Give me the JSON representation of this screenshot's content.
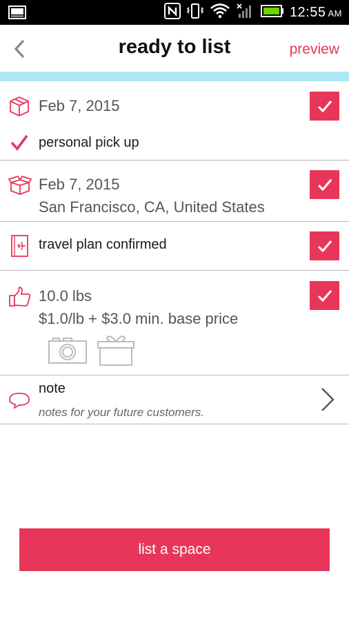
{
  "status_bar": {
    "time": "12:55",
    "ampm": "AM"
  },
  "header": {
    "title": "ready to list",
    "preview_label": "preview"
  },
  "rows": {
    "pickup": {
      "date": "Feb 7, 2015",
      "method": "personal pick up",
      "checked": true
    },
    "delivery": {
      "date": "Feb 7, 2015",
      "location": "San Francisco, CA, United States",
      "checked": true
    },
    "travel": {
      "label": "travel plan confirmed",
      "checked": true
    },
    "weight": {
      "weight": "10.0 lbs",
      "price": "$1.0/lb + $3.0 min. base price",
      "checked": true
    },
    "note": {
      "label": "note",
      "placeholder": "notes for your future customers."
    }
  },
  "footer": {
    "list_button_label": "list a space"
  },
  "colors": {
    "accent": "#e8365a",
    "accent_bar": "#aee7f5",
    "divider": "#b5b5b5"
  }
}
